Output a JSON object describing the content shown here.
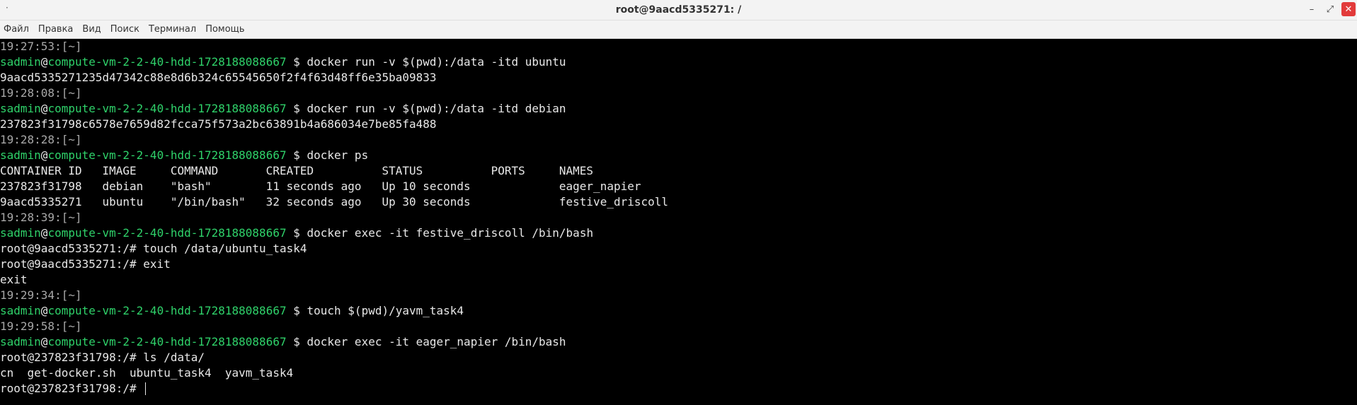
{
  "window": {
    "title": "root@9aacd5335271: /",
    "menu_dot": "·",
    "minimize": "–",
    "maximize": "⤢",
    "close": "✕"
  },
  "menubar": {
    "items": [
      "Файл",
      "Правка",
      "Вид",
      "Поиск",
      "Терминал",
      "Помощь"
    ]
  },
  "prompt": {
    "user": "sadmin",
    "at": "@",
    "host": "compute-vm-2-2-40-hdd-1728188088667",
    "symbol": " $ "
  },
  "lines": [
    {
      "kind": "ts",
      "text": "19:27:53:[~]"
    },
    {
      "kind": "prompt",
      "cmd": "docker run -v $(pwd):/data -itd ubuntu"
    },
    {
      "kind": "out",
      "text": "9aacd5335271235d47342c88e8d6b324c65545650f2f4f63d48ff6e35ba09833"
    },
    {
      "kind": "ts",
      "text": "19:28:08:[~]"
    },
    {
      "kind": "prompt",
      "cmd": "docker run -v $(pwd):/data -itd debian"
    },
    {
      "kind": "out",
      "text": "237823f31798c6578e7659d82fcca75f573a2bc63891b4a686034e7be85fa488"
    },
    {
      "kind": "ts",
      "text": "19:28:28:[~]"
    },
    {
      "kind": "prompt",
      "cmd": "docker ps"
    },
    {
      "kind": "out",
      "text": "CONTAINER ID   IMAGE     COMMAND       CREATED          STATUS          PORTS     NAMES"
    },
    {
      "kind": "out",
      "text": "237823f31798   debian    \"bash\"        11 seconds ago   Up 10 seconds             eager_napier"
    },
    {
      "kind": "out",
      "text": "9aacd5335271   ubuntu    \"/bin/bash\"   32 seconds ago   Up 30 seconds             festive_driscoll"
    },
    {
      "kind": "ts",
      "text": "19:28:39:[~]"
    },
    {
      "kind": "prompt",
      "cmd": "docker exec -it festive_driscoll /bin/bash"
    },
    {
      "kind": "out",
      "text": "root@9aacd5335271:/# touch /data/ubuntu_task4"
    },
    {
      "kind": "out",
      "text": "root@9aacd5335271:/# exit"
    },
    {
      "kind": "out",
      "text": "exit"
    },
    {
      "kind": "ts",
      "text": "19:29:34:[~]"
    },
    {
      "kind": "prompt",
      "cmd": "touch $(pwd)/yavm_task4"
    },
    {
      "kind": "ts",
      "text": "19:29:58:[~]"
    },
    {
      "kind": "prompt",
      "cmd": "docker exec -it eager_napier /bin/bash"
    },
    {
      "kind": "out",
      "text": "root@237823f31798:/# ls /data/"
    },
    {
      "kind": "out",
      "text": "cn  get-docker.sh  ubuntu_task4  yavm_task4"
    },
    {
      "kind": "cursor",
      "text": "root@237823f31798:/# "
    }
  ]
}
